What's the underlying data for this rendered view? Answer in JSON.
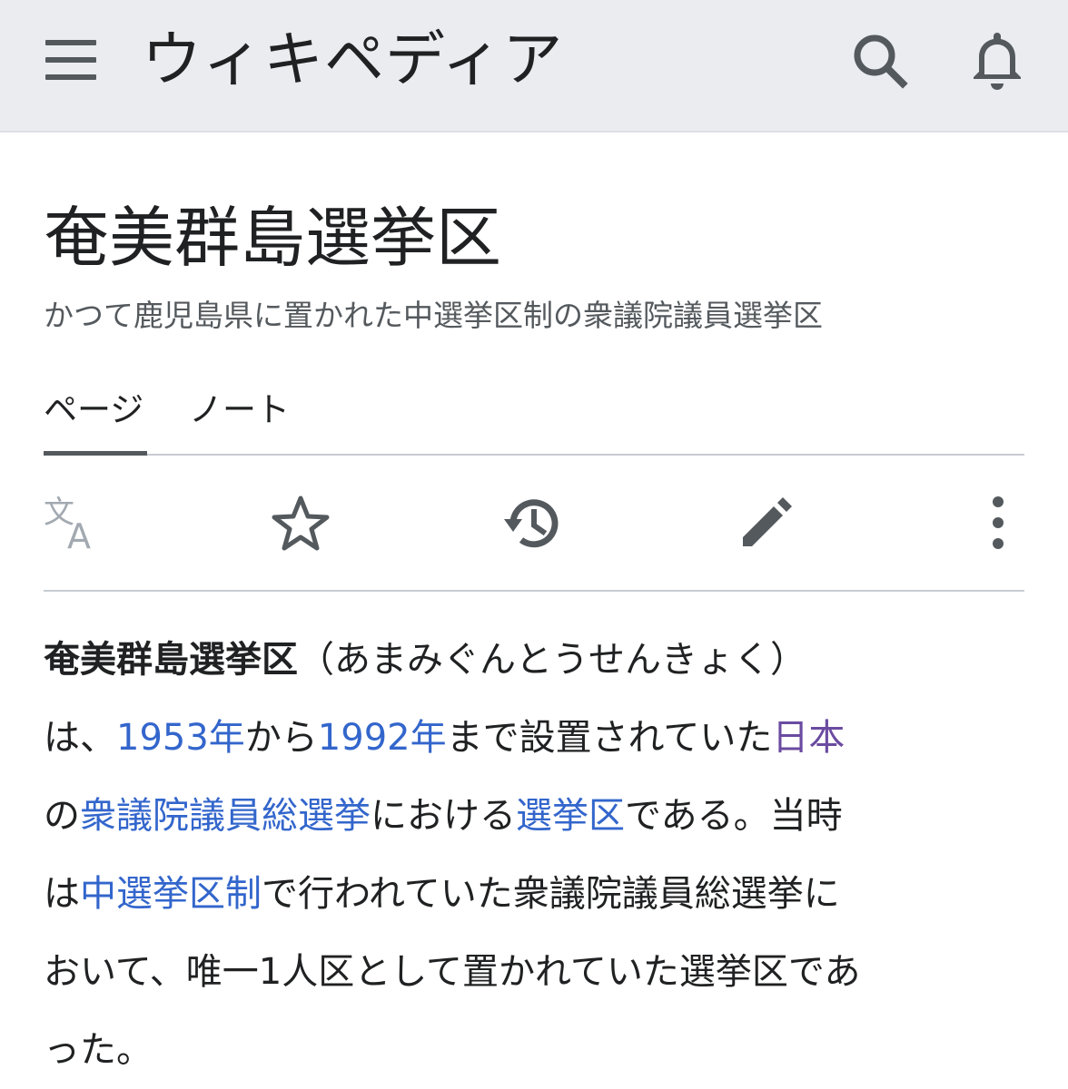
{
  "header": {
    "wordmark": "ウィキペディア",
    "menu_icon": "hamburger-menu-icon",
    "search_icon": "search-icon",
    "notifications_icon": "bell-icon"
  },
  "article": {
    "title": "奄美群島選挙区",
    "description": "かつて鹿児島県に置かれた中選挙区制の衆議院議員選挙区"
  },
  "tabs": [
    {
      "label": "ページ",
      "selected": true
    },
    {
      "label": "ノート",
      "selected": false
    }
  ],
  "actions": [
    {
      "icon": "language-icon"
    },
    {
      "icon": "star-icon"
    },
    {
      "icon": "history-icon"
    },
    {
      "icon": "edit-pencil-icon"
    },
    {
      "icon": "more-vertical-icon"
    }
  ],
  "body": {
    "lines": [
      [
        {
          "text": "奄美群島選挙区",
          "type": "bold"
        },
        {
          "text": "（あまみぐんとうせんきょく）",
          "type": "text"
        }
      ],
      [
        {
          "text": "は、",
          "type": "text"
        },
        {
          "text": "1953年",
          "type": "link"
        },
        {
          "text": "から",
          "type": "text"
        },
        {
          "text": "1992年",
          "type": "link"
        },
        {
          "text": "まで設置されていた",
          "type": "text"
        },
        {
          "text": "日本",
          "type": "visited"
        }
      ],
      [
        {
          "text": "の",
          "type": "text"
        },
        {
          "text": "衆議院議員総選挙",
          "type": "link"
        },
        {
          "text": "における",
          "type": "text"
        },
        {
          "text": "選挙区",
          "type": "link"
        },
        {
          "text": "である。当時",
          "type": "text"
        }
      ],
      [
        {
          "text": "は",
          "type": "text"
        },
        {
          "text": "中選挙区制",
          "type": "link"
        },
        {
          "text": "で行われていた衆議院議員総選挙に",
          "type": "text"
        }
      ],
      [
        {
          "text": "おいて、唯一1人区として置かれていた選挙区であ",
          "type": "text"
        }
      ],
      [
        {
          "text": "った。",
          "type": "text"
        }
      ]
    ]
  },
  "colors": {
    "header_bg": "#eaecf0",
    "link": "#3366cc",
    "visited_link": "#6b4ba1",
    "icon": "#54595d",
    "text": "#202122"
  }
}
